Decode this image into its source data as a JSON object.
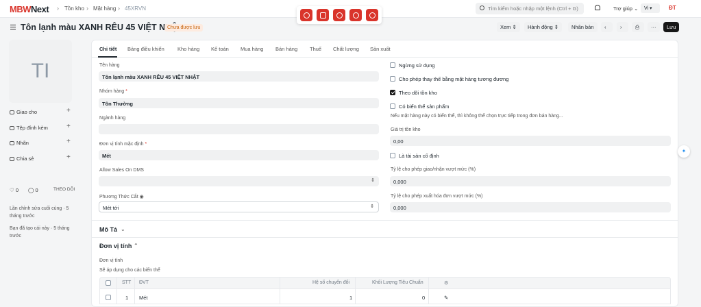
{
  "topbar": {
    "logo_m": "MBW",
    "logo_rest": "Next",
    "breadcrumbs": [
      "Tồn kho",
      "Mặt hàng",
      "45XRVN"
    ],
    "search_placeholder": "Tìm kiếm hoặc nhập một lệnh (Ctrl + G)",
    "help_label": "Trợ giúp",
    "lang_label": "Vi",
    "user_initials": "ĐT",
    "apps": [
      "app-1-icon",
      "app-2-icon",
      "app-3-icon",
      "app-4-icon",
      "app-5-icon"
    ],
    "accent": "#d9342b"
  },
  "header": {
    "title": "Tôn lạnh màu XANH RÊU 45 VIỆT NHẬT",
    "status_badge": "Chưa được lưu",
    "view_label": "Xem",
    "actions_label": "Hành động",
    "duplicate_label": "Nhân bản",
    "save_label": "Lưu"
  },
  "sidebar": {
    "image_initials": "TI",
    "assign_label": "Giao cho",
    "attach_label": "Tệp đính kèm",
    "tags_label": "Nhãn",
    "share_label": "Chia sẻ",
    "likes": "0",
    "comments": "0",
    "follow_label": "THEO DÕI",
    "last_edit": "Lần chỉnh sửa cuối cùng · 5 tháng trước",
    "created": "Bạn đã tạo cái này · 5 tháng trước"
  },
  "tabs": [
    "Chi tiết",
    "Bảng điều khiển",
    "Kho hàng",
    "Kế toán",
    "Mua hàng",
    "Bán hàng",
    "Thuế",
    "Chất lượng",
    "Sản xuất"
  ],
  "form": {
    "item_name_label": "Tên hàng",
    "item_name": "Tôn lạnh màu XANH RÊU 45 VIỆT NHẬT",
    "item_group_label": "Nhóm hàng",
    "item_group": "Tôn Thường",
    "industry_label": "Ngành hàng",
    "industry": "",
    "uom_label": "Đơn vị tính mặc định",
    "uom": "Mét",
    "allow_sales_label": "Allow Sales On DMS",
    "allow_sales": "",
    "cut_method_label": "Phương Thức Cắt",
    "cut_method": "Mét tới",
    "disabled_label": "Ngừng sử dụng",
    "allow_alt_label": "Cho phép thay thế bằng mặt hàng tương đương",
    "track_stock_label": "Theo dõi tồn kho",
    "has_variants_label": "Có biến thể sản phẩm",
    "variants_note": "Nếu mặt hàng này có biến thể, thì không thể chọn trực tiếp trong đơn bán hàng...",
    "valuation_label": "Giá trị tồn kho",
    "valuation": "0,00",
    "fixed_asset_label": "Là tài sản cố định",
    "over_delivery_label": "Tỷ lệ cho phép giao/nhận vượt mức (%)",
    "over_delivery": "0,000",
    "over_billing_label": "Tỷ lệ cho phép xuất hóa đơn vượt mức (%)",
    "over_billing": "0,000"
  },
  "sections": {
    "description": "Mô Tả",
    "uom_section": "Đơn vị tính",
    "uom_sub_label": "Đơn vị tính",
    "uom_note": "Sẽ áp dụng cho các biến thể"
  },
  "uom_table": {
    "headers": [
      "STT",
      "ĐVT",
      "Hệ số chuyển đổi",
      "Khối Lượng Tiêu Chuẩn"
    ],
    "rows": [
      {
        "idx": "1",
        "uom": "Mét",
        "factor": "1",
        "weight": "0"
      }
    ]
  }
}
